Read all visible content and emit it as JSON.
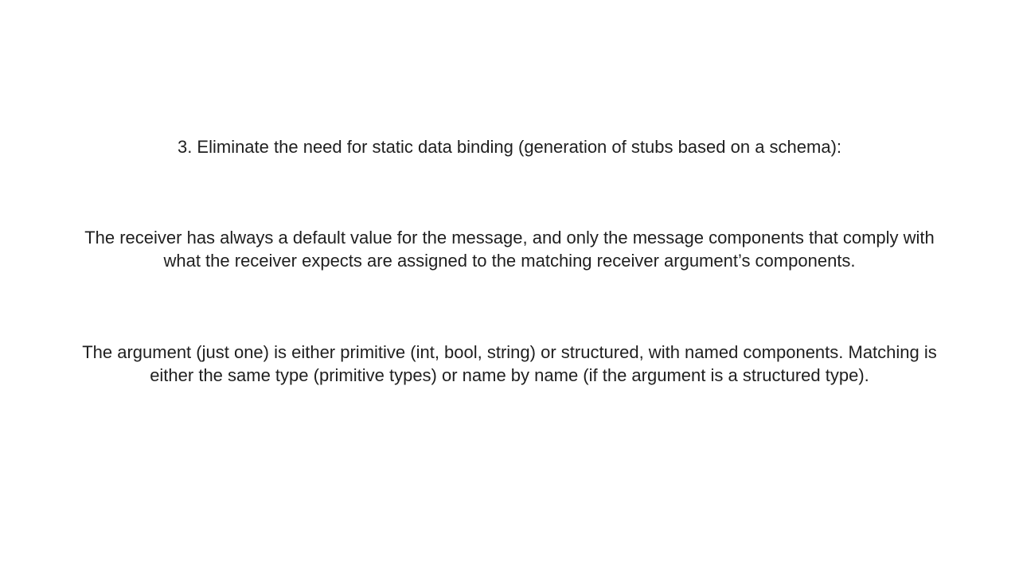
{
  "slide": {
    "heading": "3. Eliminate the need for static data binding (generation of stubs based on a schema):",
    "paragraph_receiver": "The receiver has always a default value for the message, and only the message components that comply with what the receiver expects are assigned to the matching receiver argument’s components.",
    "paragraph_argument": "The argument (just one) is either primitive (int, bool, string) or structured, with named components. Matching is either the same type (primitive types) or name by name (if the argument is a structured type)."
  },
  "colors": {
    "background": "#ffffff",
    "text": "#1f1f1f"
  }
}
